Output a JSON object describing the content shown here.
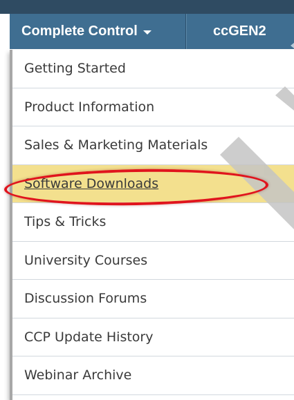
{
  "nav": {
    "tabs": [
      {
        "label": "Complete Control"
      },
      {
        "label": "ccGEN2"
      }
    ]
  },
  "menu": {
    "items": [
      {
        "label": "Getting Started"
      },
      {
        "label": "Product Information"
      },
      {
        "label": "Sales & Marketing Materials"
      },
      {
        "label": "Software Downloads"
      },
      {
        "label": "Tips & Tricks"
      },
      {
        "label": "University Courses"
      },
      {
        "label": "Discussion Forums"
      },
      {
        "label": "CCP Update History"
      },
      {
        "label": "Webinar Archive"
      }
    ],
    "highlighted_item": "Software Downloads"
  },
  "colors": {
    "nav_background": "#3f6e91",
    "highlight_background": "#f3e08e",
    "annotation_red": "#e0141d",
    "watermark_gray": "#b9b9b9"
  },
  "icons": {
    "dropdown_caret": "caret-down-icon",
    "edge_arrow": "caret-left-icon"
  }
}
